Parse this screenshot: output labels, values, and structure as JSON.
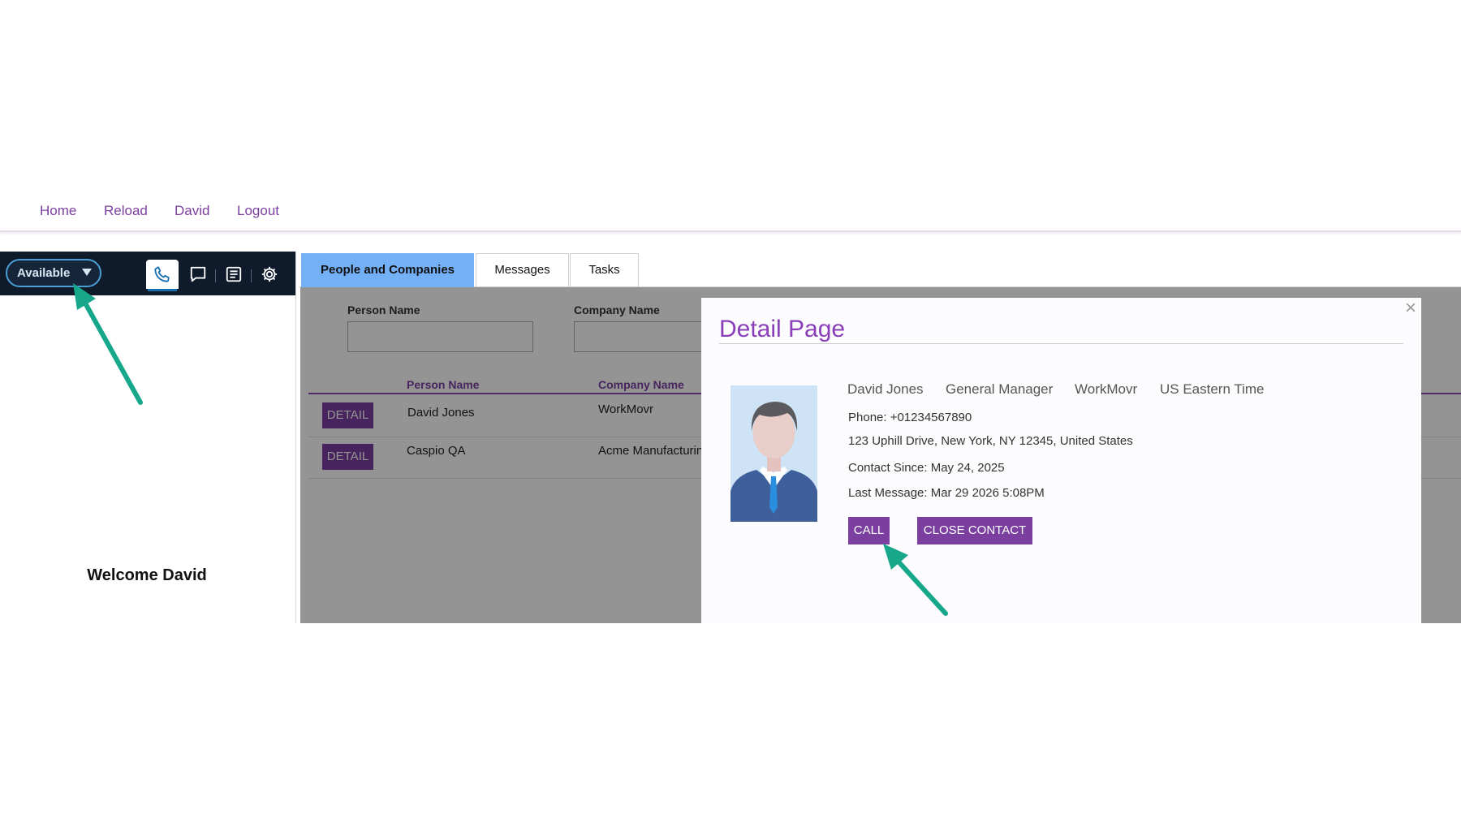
{
  "nav": {
    "home": "Home",
    "reload": "Reload",
    "user": "David",
    "logout": "Logout"
  },
  "phonebar": {
    "status": "Available",
    "icons": [
      "phone-icon",
      "chat-icon",
      "notes-icon",
      "gear-icon"
    ]
  },
  "welcome": "Welcome David",
  "tabs": [
    {
      "label": "People and Companies",
      "active": true
    },
    {
      "label": "Messages",
      "active": false
    },
    {
      "label": "Tasks",
      "active": false
    }
  ],
  "search": {
    "person_label": "Person Name",
    "company_label": "Company Name"
  },
  "grid": {
    "columns": [
      "Person Name",
      "Company Name"
    ],
    "detail_label": "DETAIL",
    "rows": [
      {
        "person": "David Jones",
        "company": "WorkMovr"
      },
      {
        "person": "Caspio QA",
        "company": "Acme Manufacturing"
      }
    ]
  },
  "modal": {
    "title": "Detail Page",
    "close": "×",
    "name": "David Jones",
    "role": "General Manager",
    "company": "WorkMovr",
    "timezone": "US Eastern Time",
    "phone": "Phone: +01234567890",
    "address": "123 Uphill Drive, New York, NY 12345, United States",
    "contact_since": "Contact Since: May 24, 2025",
    "last_message": "Last Message: Mar 29 2026 5:08PM",
    "call_label": "CALL",
    "close_contact_label": "CLOSE CONTACT"
  },
  "colors": {
    "accent": "#7b3fa0",
    "tab_active": "#74b0f5",
    "phonebar": "#0f1b2b",
    "arrow": "#17a88b"
  }
}
